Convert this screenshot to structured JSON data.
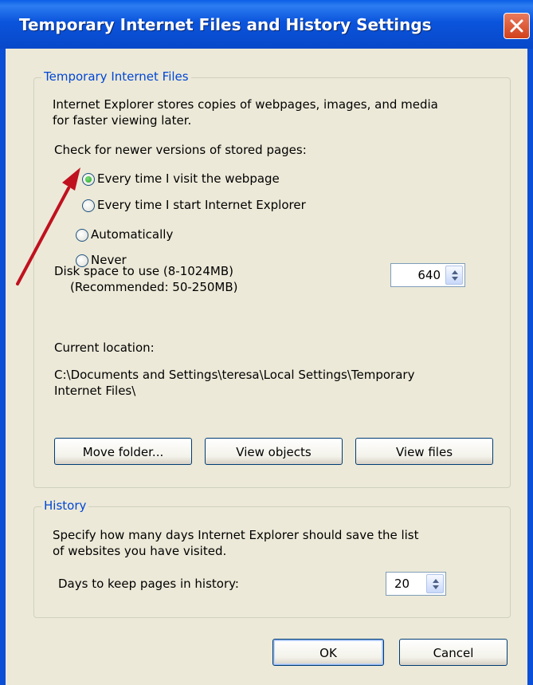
{
  "window": {
    "title": "Temporary Internet Files and History Settings",
    "close_icon": "close-icon"
  },
  "temp_files": {
    "legend": "Temporary Internet Files",
    "description_line1": "Internet Explorer stores copies of webpages, images, and media",
    "description_line2": "for faster viewing later.",
    "check_label": "Check for newer versions of stored pages:",
    "options": [
      {
        "label": "Every time I visit the webpage",
        "selected": true
      },
      {
        "label": "Every time I start Internet Explorer",
        "selected": false
      },
      {
        "label": "Automatically",
        "selected": false
      },
      {
        "label": "Never",
        "selected": false
      }
    ],
    "disk_space_label": "Disk space to use (8-1024MB)",
    "disk_space_recommended": "(Recommended: 50-250MB)",
    "disk_space_value": "640",
    "current_location_label": "Current location:",
    "location_line1": "C:\\Documents and Settings\\teresa\\Local Settings\\Temporary",
    "location_line2": "Internet Files\\",
    "buttons": {
      "move_folder": "Move folder...",
      "view_objects": "View objects",
      "view_files": "View files"
    }
  },
  "history": {
    "legend": "History",
    "description_line1": "Specify how many days Internet Explorer should save the list",
    "description_line2": "of websites you have visited.",
    "days_label": "Days to keep pages in history:",
    "days_value": "20"
  },
  "footer": {
    "ok": "OK",
    "cancel": "Cancel"
  },
  "colors": {
    "title_bar": "#0a54dc",
    "dialog_bg": "#ece9d8",
    "legend_text": "#0046d5",
    "annotation_arrow": "#c0111f"
  }
}
